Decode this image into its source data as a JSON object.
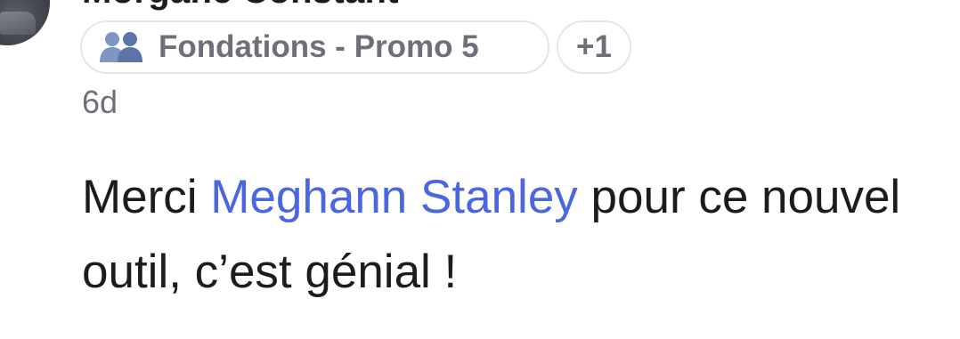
{
  "post": {
    "author": {
      "name": "Morgane Constant"
    },
    "groups": {
      "primary": {
        "icon": "group-icon",
        "label": "Fondations - Promo 5"
      },
      "more_label": "+1"
    },
    "timestamp": "6d",
    "message": {
      "before": "Merci ",
      "mention": "Meghann Stanley",
      "after": " pour ce nouvel outil, c’est génial !"
    }
  },
  "colors": {
    "mention": "#4a66e0",
    "chip_text": "#6e7079",
    "chip_border": "#e4e5e9",
    "body_text": "#1c1c1e"
  }
}
